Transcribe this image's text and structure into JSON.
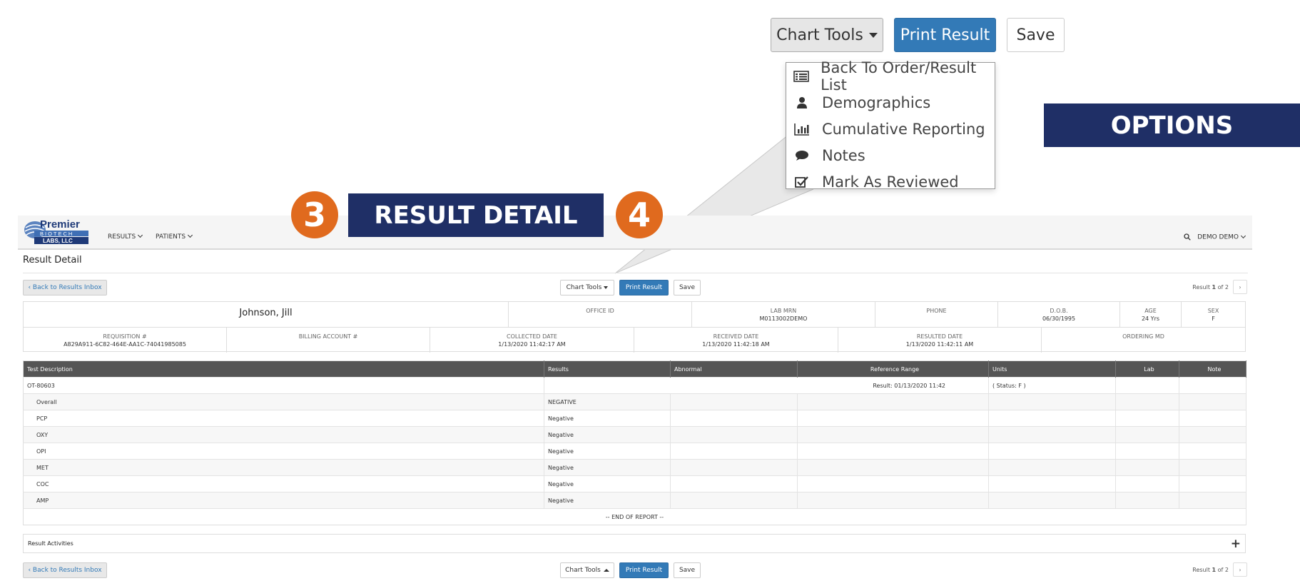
{
  "callout": {
    "chart_tools_label": "Chart Tools",
    "print_label": "Print Result",
    "save_label": "Save",
    "menu_items": [
      {
        "label": "Back To Order/Result List",
        "icon": "list-icon"
      },
      {
        "label": "Demographics",
        "icon": "user-icon"
      },
      {
        "label": "Cumulative Reporting",
        "icon": "bar-chart-icon"
      },
      {
        "label": "Notes",
        "icon": "comment-icon"
      },
      {
        "label": "Mark As Reviewed",
        "icon": "check-square-icon"
      }
    ],
    "options_banner": "OPTIONS",
    "detail_banner": "RESULT DETAIL",
    "step3": "3",
    "step4": "4"
  },
  "navbar": {
    "logo_top": "Premier",
    "logo_mid": "BIOTECH",
    "logo_bottom": "LABS, LLC",
    "results": "RESULTS",
    "patients": "PATIENTS",
    "user": "DEMO DEMO"
  },
  "page": {
    "title": "Result Detail",
    "back_label": "‹ Back to Results Inbox",
    "chart_tools_label": "Chart Tools",
    "print_label": "Print Result",
    "save_label": "Save",
    "pager_prefix": "Result",
    "pager_current": "1",
    "pager_of": "of 2",
    "pager_next": "›"
  },
  "patient": {
    "name": "Johnson, Jill",
    "office_id_label": "OFFICE ID",
    "lab_mrn_label": "LAB MRN",
    "lab_mrn": "M0113002DEMO",
    "phone_label": "PHONE",
    "dob_label": "D.O.B.",
    "dob": "06/30/1995",
    "age_label": "AGE",
    "age": "24 Yrs",
    "sex_label": "SEX",
    "sex": "F",
    "requisition_label": "REQUISITION #",
    "requisition": "A829A911-6C82-464E-AA1C-74041985085",
    "billing_label": "BILLING ACCOUNT #",
    "collected_label": "COLLECTED DATE",
    "collected": "1/13/2020 11:42:17 AM",
    "received_label": "RECEIVED DATE",
    "received": "1/13/2020 11:42:18 AM",
    "resulted_label": "RESULTED DATE",
    "resulted": "1/13/2020 11:42:11 AM",
    "ordering_label": "ORDERING MD"
  },
  "results_table": {
    "headers": [
      "Test Description",
      "Results",
      "Abnormal",
      "Reference Range",
      "Units",
      "Lab",
      "Note"
    ],
    "order_code": "OT-80603",
    "order_result": "Result: 01/13/2020 11:42",
    "order_status": "( Status: F )",
    "rows": [
      {
        "test": "Overall",
        "result": "NEGATIVE"
      },
      {
        "test": "PCP",
        "result": "Negative"
      },
      {
        "test": "OXY",
        "result": "Negative"
      },
      {
        "test": "OPI",
        "result": "Negative"
      },
      {
        "test": "MET",
        "result": "Negative"
      },
      {
        "test": "COC",
        "result": "Negative"
      },
      {
        "test": "AMP",
        "result": "Negative"
      }
    ],
    "end_text": "-- END OF REPORT --"
  },
  "activities": {
    "label": "Result Activities",
    "expand": "+"
  }
}
